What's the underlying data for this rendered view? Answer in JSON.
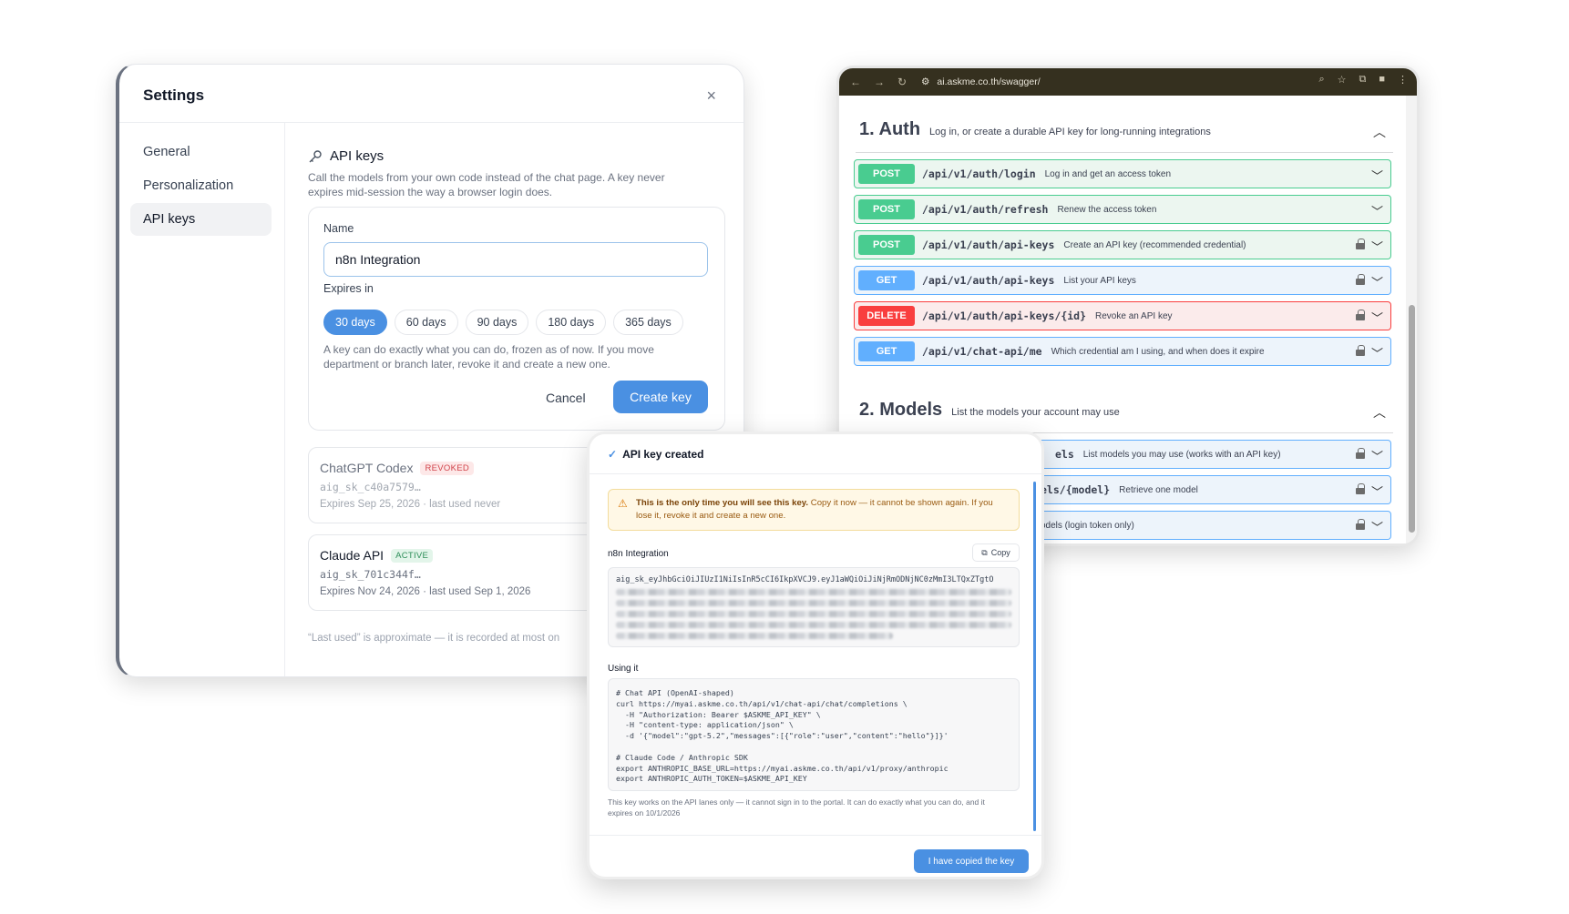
{
  "settings": {
    "title": "Settings",
    "close_icon": "×",
    "nav": [
      {
        "label": "General"
      },
      {
        "label": "Personalization"
      },
      {
        "label": "API keys"
      }
    ],
    "section_title": "API keys",
    "section_desc": "Call the models from your own code instead of the chat page. A key never expires mid-session the way a browser login does.",
    "form": {
      "name_label": "Name",
      "name_value": "n8n Integration",
      "expires_label": "Expires in",
      "chips": [
        "30 days",
        "60 days",
        "90 days",
        "180 days",
        "365 days"
      ],
      "selected_chip": "30 days",
      "note": "A key can do exactly what you can do, frozen as of now. If you move department or branch later, revoke it and create a new one.",
      "cancel": "Cancel",
      "create": "Create key"
    },
    "keys": [
      {
        "name": "ChatGPT Codex",
        "badge": "REVOKED",
        "id": "aig_sk_c40a7579…",
        "meta": "Expires Sep 25, 2026 · last used never"
      },
      {
        "name": "Claude API",
        "badge": "ACTIVE",
        "id": "aig_sk_701c344f…",
        "meta": "Expires Nov 24, 2026 · last used Sep 1, 2026"
      }
    ],
    "footnote": "“Last used” is approximate — it is recorded at most on"
  },
  "browser": {
    "url": "ai.askme.co.th/swagger/",
    "groups": [
      {
        "title": "1. Auth",
        "desc": "Log in, or create a durable API key for long-running integrations"
      },
      {
        "title": "2. Models",
        "desc": "List the models your account may use"
      }
    ],
    "ops": [
      {
        "method": "POST",
        "path": "/api/v1/auth/login",
        "summary": "Log in and get an access token",
        "locked": false
      },
      {
        "method": "POST",
        "path": "/api/v1/auth/refresh",
        "summary": "Renew the access token",
        "locked": false
      },
      {
        "method": "POST",
        "path": "/api/v1/auth/api-keys",
        "summary": "Create an API key (recommended credential)",
        "locked": true
      },
      {
        "method": "GET",
        "path": "/api/v1/auth/api-keys",
        "summary": "List your API keys",
        "locked": true
      },
      {
        "method": "DELETE",
        "path": "/api/v1/auth/api-keys/{id}",
        "summary": "Revoke an API key",
        "locked": true
      },
      {
        "method": "GET",
        "path": "/api/v1/chat-api/me",
        "summary": "Which credential am I using, and when does it expire",
        "locked": true
      }
    ],
    "model_ops": [
      {
        "path": "els",
        "summary": "List models you may use (works with an API key)"
      },
      {
        "path": "els/{model}",
        "summary": "Retrieve one model"
      },
      {
        "path": "",
        "summary": "odels (login token only)"
      }
    ]
  },
  "modal": {
    "title": "API key created",
    "warning_bold": "This is the only time you will see this key.",
    "warning_rest": " Copy it now — it cannot be shown again. If you lose it, revoke it and create a new one.",
    "key_label": "n8n Integration",
    "copy": "Copy",
    "key_first_line": "aig_sk_eyJhbGciOiJIUzI1NiIsInR5cCI6IkpXVCJ9.eyJ1aWQiOiJiNjRmODNjNC0zMmI3LTQxZTgtO",
    "using_label": "Using it",
    "code": [
      "# Chat API (OpenAI-shaped)",
      "curl https://myai.askme.co.th/api/v1/chat-api/chat/completions \\",
      "  -H \"Authorization: Bearer $ASKME_API_KEY\" \\",
      "  -H \"content-type: application/json\" \\",
      "  -d '{\"model\":\"gpt-5.2\",\"messages\":[{\"role\":\"user\",\"content\":\"hello\"}]}'",
      "",
      "# Claude Code / Anthropic SDK",
      "export ANTHROPIC_BASE_URL=https://myai.askme.co.th/api/v1/proxy/anthropic",
      "export ANTHROPIC_AUTH_TOKEN=$ASKME_API_KEY"
    ],
    "fine_print": "This key works on the API lanes only — it cannot sign in to the portal. It can do exactly what you can do, and it expires on 10/1/2026",
    "ack": "I have copied the key"
  }
}
